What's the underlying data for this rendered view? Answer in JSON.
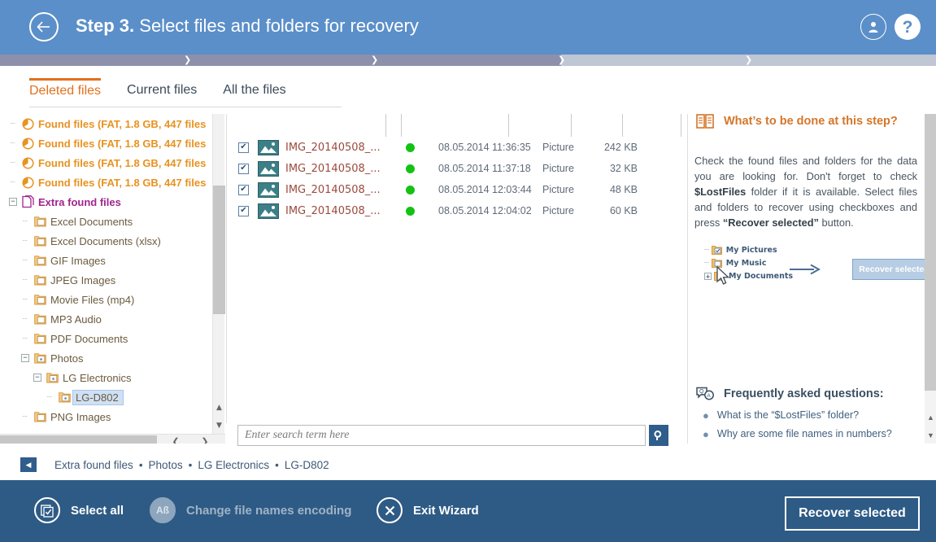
{
  "header": {
    "step_label": "Step 3.",
    "title": "Select files and folders for recovery",
    "back_icon": "arrow-left-icon",
    "user_icon": "user-account-icon",
    "help_icon": "?"
  },
  "progress": {
    "completed_steps": 3,
    "total_steps": 5
  },
  "tabs": [
    {
      "label": "Deleted files",
      "active": true
    },
    {
      "label": "Current files",
      "active": false
    },
    {
      "label": "All the files",
      "active": false
    }
  ],
  "tree": {
    "items": [
      {
        "label": "Found files (FAT, 1.8 GB, 447 files",
        "kind": "found",
        "indent": 0,
        "expander": "dots"
      },
      {
        "label": "Found files (FAT, 1.8 GB, 447 files",
        "kind": "found",
        "indent": 0,
        "expander": "dots"
      },
      {
        "label": "Found files (FAT, 1.8 GB, 447 files",
        "kind": "found",
        "indent": 0,
        "expander": "dots"
      },
      {
        "label": "Found files (FAT, 1.8 GB, 447 files",
        "kind": "found",
        "indent": 0,
        "expander": "dots"
      },
      {
        "label": "Extra found files",
        "kind": "extra",
        "indent": 0,
        "expander": "minus"
      },
      {
        "label": "Excel Documents",
        "kind": "folder",
        "indent": 1,
        "expander": "dots"
      },
      {
        "label": "Excel Documents (xlsx)",
        "kind": "folder",
        "indent": 1,
        "expander": "dots"
      },
      {
        "label": "GIF Images",
        "kind": "folder",
        "indent": 1,
        "expander": "dots"
      },
      {
        "label": "JPEG Images",
        "kind": "folder",
        "indent": 1,
        "expander": "dots"
      },
      {
        "label": "Movie Files (mp4)",
        "kind": "folder",
        "indent": 1,
        "expander": "dots"
      },
      {
        "label": "MP3 Audio",
        "kind": "folder",
        "indent": 1,
        "expander": "dots"
      },
      {
        "label": "PDF Documents",
        "kind": "folder",
        "indent": 1,
        "expander": "dots"
      },
      {
        "label": "Photos",
        "kind": "folder-open",
        "indent": 1,
        "expander": "minus"
      },
      {
        "label": "LG Electronics",
        "kind": "folder-open",
        "indent": 2,
        "expander": "minus"
      },
      {
        "label": "LG-D802",
        "kind": "folder-open",
        "indent": 3,
        "expander": "dots",
        "selected": true
      },
      {
        "label": "PNG Images",
        "kind": "folder",
        "indent": 1,
        "expander": "dots"
      }
    ]
  },
  "filelist": {
    "rows": [
      {
        "checked": true,
        "name": "IMG_20140508_...",
        "status": "ok",
        "date": "08.05.2014 11:36:35",
        "type": "Picture",
        "size": "242 KB"
      },
      {
        "checked": true,
        "name": "IMG_20140508_...",
        "status": "ok",
        "date": "08.05.2014 11:37:18",
        "type": "Picture",
        "size": "32 KB"
      },
      {
        "checked": true,
        "name": "IMG_20140508_...",
        "status": "ok",
        "date": "08.05.2014 12:03:44",
        "type": "Picture",
        "size": "48 KB"
      },
      {
        "checked": true,
        "name": "IMG_20140508_...",
        "status": "ok",
        "date": "08.05.2014 12:04:02",
        "type": "Picture",
        "size": "60 KB"
      }
    ]
  },
  "search": {
    "value": "",
    "placeholder": "Enter search term here",
    "icon": "search-icon"
  },
  "info": {
    "section_title": "What’s to be done at this step?",
    "book_icon": "open-book-icon",
    "body_1": "Check the found files and folders for the data you are looking for. Don't forget to check ",
    "body_bold_1": "$LostFiles",
    "body_2": " folder if it is available. Select files and folders to recover using checkboxes and press ",
    "body_bold_2": "“Recover selected”",
    "body_3": " button.",
    "illustration": {
      "items": [
        "My Pictures",
        "My Music",
        "My Documents"
      ],
      "button_label": "Recover selected",
      "arrow_icon": "arrow-right-icon",
      "cursor_icon": "mouse-cursor-icon"
    },
    "faq_title": "Frequently asked questions:",
    "faq_icon": "speech-bubbles-qa-icon",
    "faq_items": [
      "What is the “$LostFiles” folder?",
      "Why are some file names in numbers?"
    ]
  },
  "breadcrumb": {
    "back_icon": "triangle-left-icon",
    "items": [
      "Extra found files",
      "Photos",
      "LG Electronics",
      "LG-D802"
    ],
    "separator": "•"
  },
  "footer": {
    "actions": [
      {
        "label": "Select all",
        "icon": "select-all-icon",
        "disabled": false
      },
      {
        "label": "Change file names encoding",
        "icon": "Aß",
        "disabled": true
      },
      {
        "label": "Exit Wizard",
        "icon": "close-x-icon",
        "disabled": false
      }
    ],
    "recover_label": "Recover selected"
  },
  "colors": {
    "header_blue": "#5b8fc9",
    "footer_blue": "#2e5b85",
    "accent_orange": "#e2711d",
    "found_orange": "#e8921f",
    "extra_purple": "#a0258e",
    "status_green": "#14c214",
    "filename_red": "#9b4a3c"
  }
}
